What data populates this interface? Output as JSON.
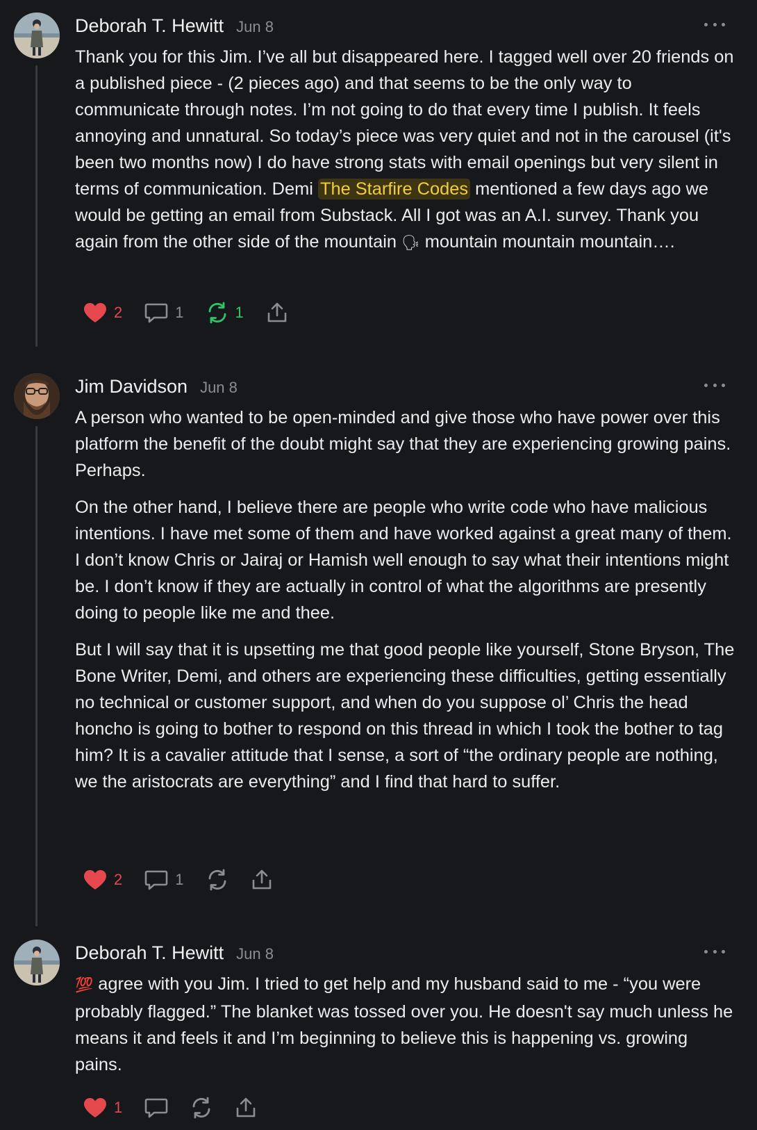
{
  "comments": [
    {
      "author": "Deborah T. Hewitt",
      "date": "Jun 8",
      "text_lines": [
        "Thank you for this Jim. I’ve all but disappeared here. I tagged well over 20 friends on a published piece - (2 pieces ago) and that seems to be the only way to communicate through notes. I’m not going to do that every time I publish. It feels annoying and unnatural. So today’s piece was very quiet and not in the carousel (it's been two months now) I do have strong stats with email openings but very silent in terms of communication. Demi "
      ],
      "mention": "The Starfire Codes",
      "text_after_mention": " mentioned a few days ago we would be getting an email from Substack. All I got was an A.I. survey. Thank you again from the other side of the mountain ",
      "emoji": "🗣",
      "text_end": " mountain mountain mountain….",
      "likes": "2",
      "replies": "1",
      "restacks": "1"
    },
    {
      "author": "Jim Davidson",
      "date": "Jun 8",
      "paragraphs": [
        "A person who wanted to be open-minded and give those who have power over this platform the benefit of the doubt might say that they are experiencing growing pains. Perhaps.",
        "On the other hand, I believe there are people who write code who have malicious intentions. I have met some of them and have worked against a great many of them. I don’t know Chris or Jairaj or Hamish well enough to say what their intentions might be. I don’t know if they are actually in control of what the algorithms are presently doing to people like me and thee.",
        "But I will say that it is upsetting me that good people like yourself, Stone Bryson, The Bone Writer, Demi, and others are experiencing these difficulties, getting essentially no technical or customer support, and when do you suppose ol’ Chris the head honcho is going to bother to respond on this thread in which I took the bother to tag him? It is a cavalier attitude that I sense, a sort of “the ordinary people are nothing, we the aristocrats are everything” and I find that hard to suffer."
      ],
      "likes": "2",
      "replies": "1"
    },
    {
      "author": "Deborah T. Hewitt",
      "date": "Jun 8",
      "emoji": "💯",
      "text": " agree with you Jim. I tried to get help and my husband said to me - “you were probably flagged.” The blanket was tossed over you. He doesn't say much unless he means it and feels it and I’m beginning to believe this is happening vs. growing pains.",
      "likes": "1"
    }
  ],
  "icons": {
    "like": "heart-icon",
    "reply": "comment-bubble-icon",
    "restack": "restack-icon",
    "share": "share-icon",
    "more": "more-dots-icon"
  },
  "colors": {
    "background": "#17181c",
    "like": "#e5484d",
    "restack_active": "#30c46a",
    "mention_bg": "#3e3613",
    "mention_text": "#f3cc3f",
    "muted": "#8c8d92"
  }
}
